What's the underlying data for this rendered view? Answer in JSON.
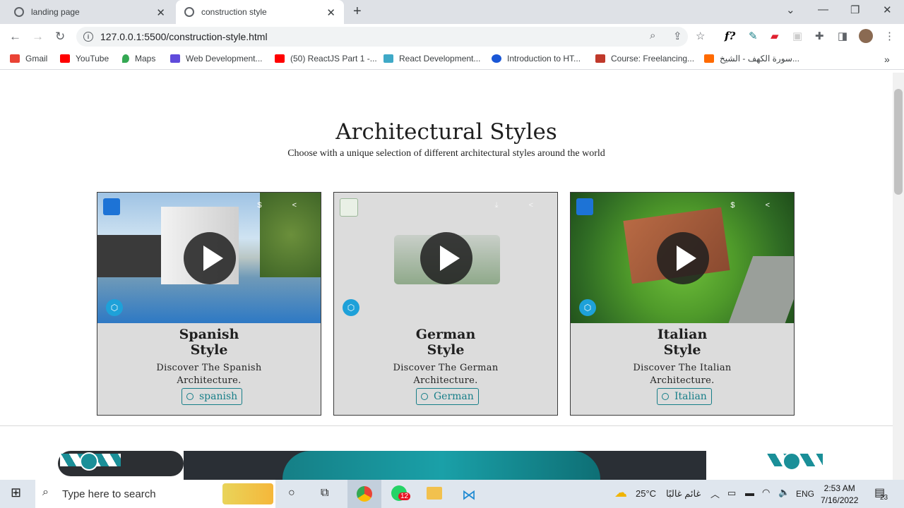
{
  "browser": {
    "tabs": [
      {
        "label": "landing page",
        "active": false
      },
      {
        "label": "construction style",
        "active": true
      }
    ],
    "url": "127.0.0.1:5500/construction-style.html",
    "bookmarks": [
      {
        "label": "Gmail",
        "color": "#ea4335"
      },
      {
        "label": "YouTube",
        "color": "#ff0000"
      },
      {
        "label": "Maps",
        "color": "#34a853"
      },
      {
        "label": "Web Development...",
        "color": "#5f4bdb"
      },
      {
        "label": "(50) ReactJS Part 1 -...",
        "color": "#ff0000"
      },
      {
        "label": "React Development...",
        "color": "#3fa9c7"
      },
      {
        "label": "Introduction to HT...",
        "color": "#1a57d6"
      },
      {
        "label": "Course: Freelancing...",
        "color": "#c0392b"
      },
      {
        "label": "سورة الكهف - الشيخ...",
        "color": "#ff6a00"
      }
    ]
  },
  "page": {
    "title": "Architectural Styles",
    "subtitle": "Choose with a unique selection of different architectural styles around the world",
    "cards": [
      {
        "name_line1": "Spanish",
        "name_line2": "Style",
        "desc_line1": "Discover The Spanish",
        "desc_line2": "Architecture.",
        "button": "spanish"
      },
      {
        "name_line1": "German",
        "name_line2": "Style",
        "desc_line1": "Discover The German",
        "desc_line2": "Architecture.",
        "button": "German"
      },
      {
        "name_line1": "Italian",
        "name_line2": "Style",
        "desc_line1": "Discover The Italian",
        "desc_line2": "Architecture.",
        "button": "Italian"
      }
    ]
  },
  "taskbar": {
    "search_placeholder": "Type here to search",
    "weather": "25°C",
    "weather_text": "غائم غالبًا",
    "lang": "ENG",
    "time": "2:53 AM",
    "date": "7/16/2022",
    "notifications": "23",
    "whatsapp_badge": "12"
  }
}
